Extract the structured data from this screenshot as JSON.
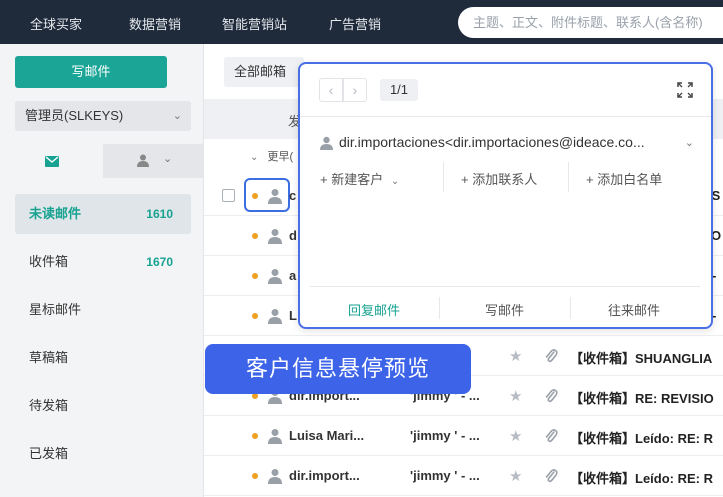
{
  "topnav": {
    "items": [
      "全球买家",
      "数据营销",
      "智能营销站",
      "广告营销"
    ],
    "search_placeholder": "主题、正文、附件标题、联系人(含名称)"
  },
  "sidebar": {
    "compose_label": "写邮件",
    "account_label": "管理员(SLKEYS)",
    "folders": [
      {
        "label": "未读邮件",
        "count": "1610"
      },
      {
        "label": "收件箱",
        "count": "1670"
      },
      {
        "label": "星标邮件",
        "count": ""
      },
      {
        "label": "草稿箱",
        "count": ""
      },
      {
        "label": "待发箱",
        "count": ""
      },
      {
        "label": "已发箱",
        "count": ""
      }
    ]
  },
  "main": {
    "filter_label": "全部邮箱",
    "list_head": "发",
    "group_label": "更早(",
    "rows": [
      {
        "sender": "c",
        "to": "",
        "subject": "IS"
      },
      {
        "sender": "d",
        "to": "",
        "subject": "O"
      },
      {
        "sender": "a",
        "to": "",
        "subject": "-"
      },
      {
        "sender": "L",
        "to": "",
        "subject": "-"
      },
      {
        "sender": "",
        "to": "",
        "subject": "【收件箱】SHUANGLIA"
      },
      {
        "sender": "dir.import...",
        "to": "'jimmy ' - ...",
        "subject": "【收件箱】RE: REVISIO"
      },
      {
        "sender": "Luisa Mari...",
        "to": "'jimmy ' - ...",
        "subject": "【收件箱】Leído: RE: R"
      },
      {
        "sender": "dir.import...",
        "to": "'jimmy ' - ...",
        "subject": "【收件箱】Leído: RE: R"
      }
    ]
  },
  "popover": {
    "page_count": "1/1",
    "contact": "dir.importaciones<dir.importaciones@ideace.co...",
    "actions": [
      "新建客户",
      "添加联系人",
      "添加白名单"
    ],
    "footer": [
      "回复邮件",
      "写邮件",
      "往来邮件"
    ]
  },
  "banner_text": "客户信息悬停预览",
  "colors": {
    "accent": "#1aa596",
    "highlight": "#3c63e8",
    "unread_dot": "#f0a020"
  }
}
